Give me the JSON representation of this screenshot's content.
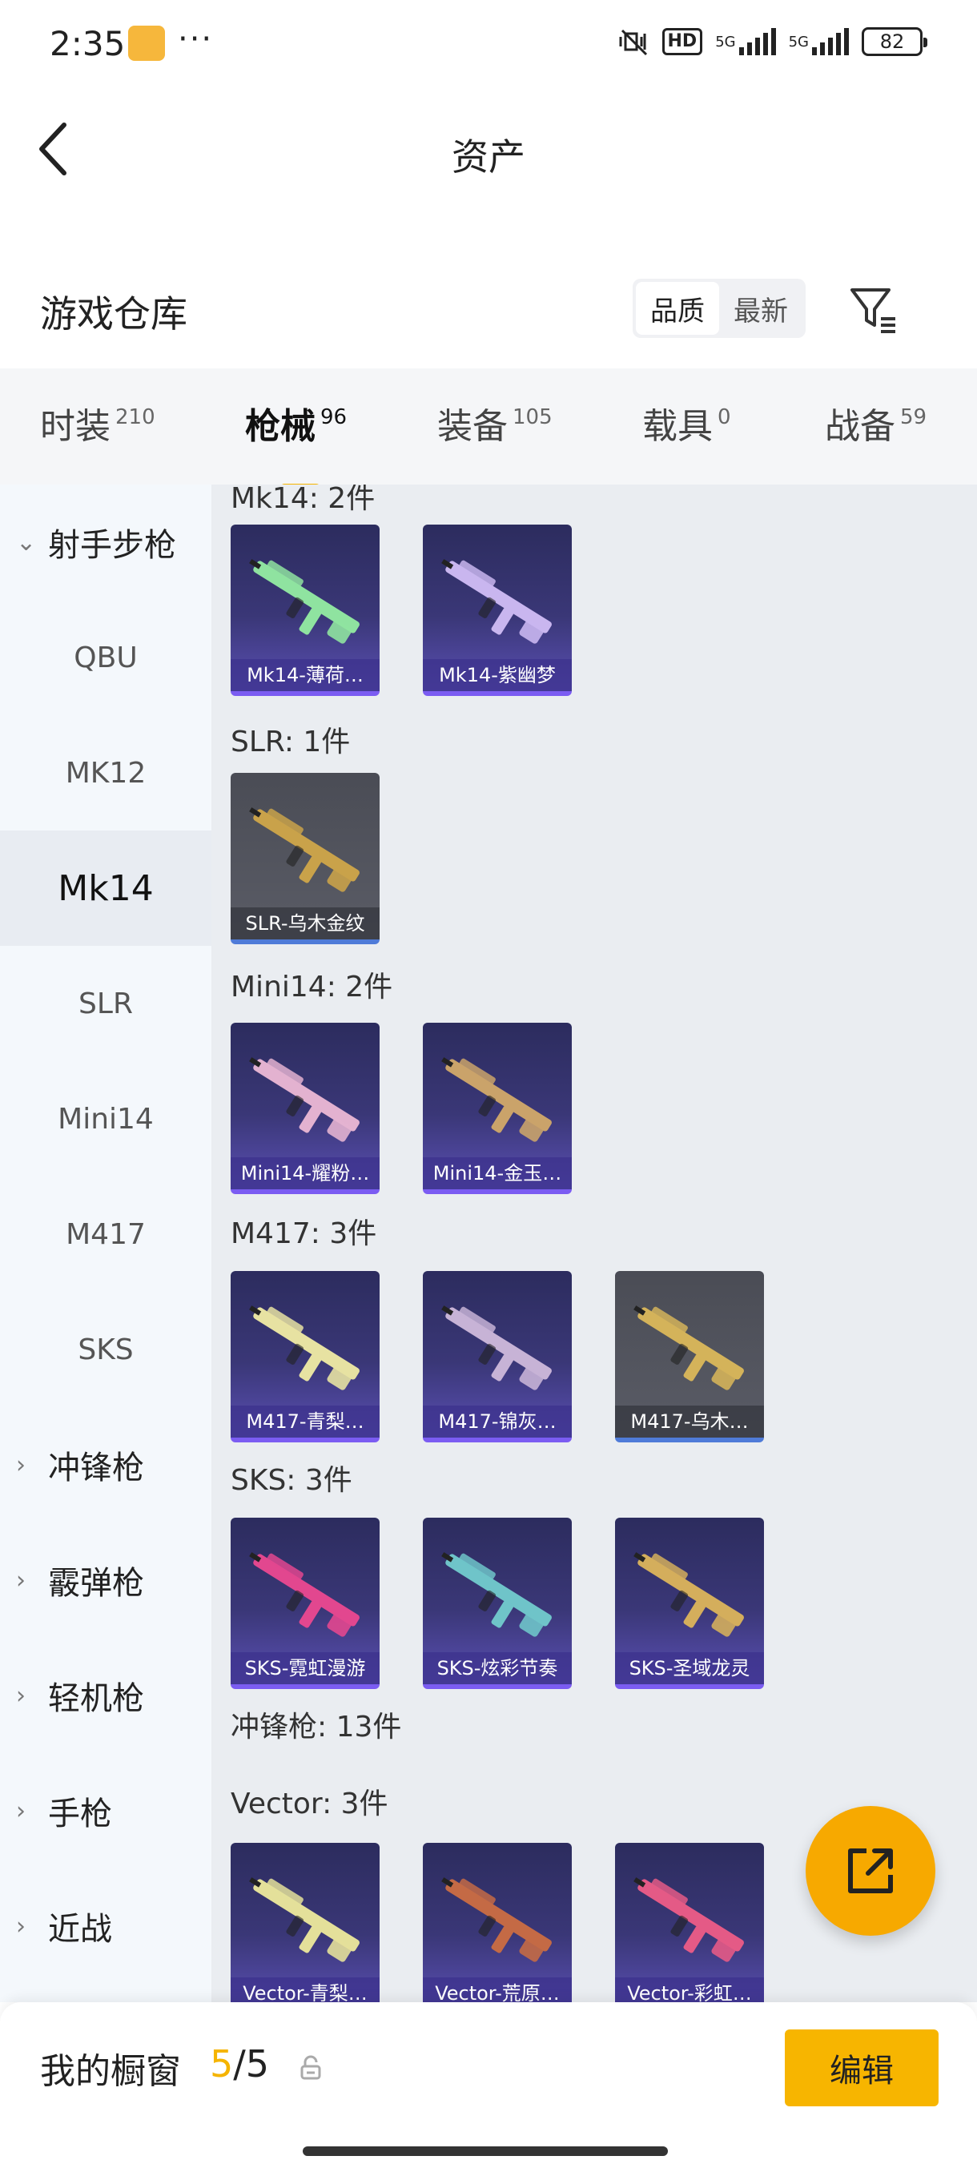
{
  "status_bar": {
    "time": "2:35",
    "more": "···",
    "hd": "HD",
    "net1": "5G",
    "net2": "5G",
    "battery": "82"
  },
  "nav": {
    "title": "资产",
    "back_icon": "chevron-left-icon"
  },
  "warehouse": {
    "label": "游戏仓库",
    "sort_options": [
      "品质",
      "最新"
    ],
    "sort_selected": "品质",
    "filter_icon": "filter-icon"
  },
  "tabs": [
    {
      "label": "时装",
      "count": "210"
    },
    {
      "label": "枪械",
      "count": "96",
      "active": true
    },
    {
      "label": "装备",
      "count": "105"
    },
    {
      "label": "载具",
      "count": "0"
    },
    {
      "label": "战备",
      "count": "59"
    }
  ],
  "sidebar": {
    "items": [
      {
        "label": "射手步枪",
        "type": "group",
        "expanded": true
      },
      {
        "label": "QBU"
      },
      {
        "label": "MK12"
      },
      {
        "label": "Mk14",
        "selected": true
      },
      {
        "label": "SLR"
      },
      {
        "label": "Mini14"
      },
      {
        "label": "M417"
      },
      {
        "label": "SKS"
      },
      {
        "label": "冲锋枪",
        "type": "group"
      },
      {
        "label": "霰弹枪",
        "type": "group"
      },
      {
        "label": "轻机枪",
        "type": "group"
      },
      {
        "label": "手枪",
        "type": "group"
      },
      {
        "label": "近战",
        "type": "group"
      }
    ]
  },
  "content": {
    "sections": [
      {
        "title": "Mk14: 2件",
        "items": [
          {
            "name": "Mk14-薄荷…",
            "rarity": "purple",
            "color": "#8fe3a0"
          },
          {
            "name": "Mk14-紫幽梦",
            "rarity": "purple",
            "color": "#c9b6ef"
          }
        ]
      },
      {
        "title": "SLR: 1件",
        "items": [
          {
            "name": "SLR-乌木金纹",
            "rarity": "gray",
            "color": "#c9a24a"
          }
        ]
      },
      {
        "title": "Mini14: 2件",
        "items": [
          {
            "name": "Mini14-耀粉…",
            "rarity": "purple",
            "color": "#e3b2d0"
          },
          {
            "name": "Mini14-金玉…",
            "rarity": "purple",
            "color": "#caa36a"
          }
        ]
      },
      {
        "title": "M417: 3件",
        "items": [
          {
            "name": "M417-青梨…",
            "rarity": "purple",
            "color": "#e7e2a2"
          },
          {
            "name": "M417-锦灰…",
            "rarity": "purple",
            "color": "#c7b3d6"
          },
          {
            "name": "M417-乌木…",
            "rarity": "gray",
            "color": "#d4b35a"
          }
        ]
      },
      {
        "title": "SKS: 3件",
        "items": [
          {
            "name": "SKS-霓虹漫游",
            "rarity": "purple",
            "color": "#e2478f"
          },
          {
            "name": "SKS-炫彩节奏",
            "rarity": "purple",
            "color": "#6fc4c9"
          },
          {
            "name": "SKS-圣域龙灵",
            "rarity": "purple",
            "color": "#d4ae5c"
          }
        ]
      },
      {
        "title": "冲锋枪: 13件",
        "items": []
      },
      {
        "title": "Vector: 3件",
        "items": [
          {
            "name": "Vector-青梨…",
            "rarity": "purple",
            "color": "#e4e09a"
          },
          {
            "name": "Vector-荒原…",
            "rarity": "purple",
            "color": "#c46a45"
          },
          {
            "name": "Vector-彩虹…",
            "rarity": "purple",
            "color": "#e45a86"
          }
        ]
      }
    ]
  },
  "fab": {
    "icon": "share-external-icon"
  },
  "bottom_bar": {
    "label": "我的橱窗",
    "current": "5",
    "separator": "/",
    "total": "5",
    "lock_icon": "lock-icon",
    "edit_label": "编辑"
  }
}
